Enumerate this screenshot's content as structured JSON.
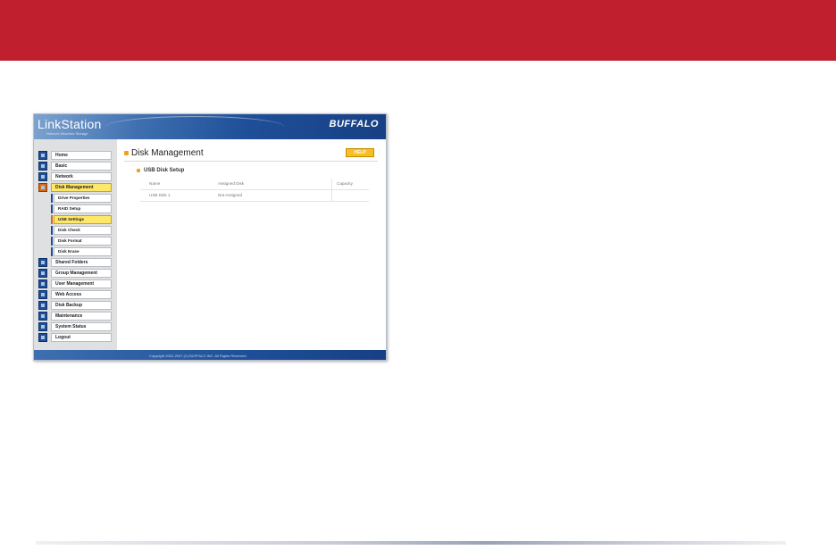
{
  "header": {
    "product": "LinkStation",
    "product_sub": "Network Attached Storage",
    "brand": "BUFFALO"
  },
  "sidebar": {
    "items": [
      {
        "label": "Home",
        "icon": "home-icon",
        "active": false
      },
      {
        "label": "Basic",
        "icon": "basic-settings-icon",
        "active": false
      },
      {
        "label": "Network",
        "icon": "network-icon",
        "active": false
      },
      {
        "label": "Disk Management",
        "icon": "disk-icon",
        "active": true
      },
      {
        "label": "Shared Folders",
        "icon": "folder-icon",
        "active": false
      },
      {
        "label": "Group Management",
        "icon": "group-icon",
        "active": false
      },
      {
        "label": "User Management",
        "icon": "user-icon",
        "active": false
      },
      {
        "label": "Web Access",
        "icon": "web-icon",
        "active": false
      },
      {
        "label": "Disk Backup",
        "icon": "backup-icon",
        "active": false
      },
      {
        "label": "Maintenance",
        "icon": "maintenance-icon",
        "active": false
      },
      {
        "label": "System Status",
        "icon": "status-icon",
        "active": false
      },
      {
        "label": "Logout",
        "icon": "logout-icon",
        "active": false
      }
    ],
    "subitems": [
      {
        "label": "Drive Properties",
        "active": false
      },
      {
        "label": "RAID Setup",
        "active": false
      },
      {
        "label": "USB Settings",
        "active": true
      },
      {
        "label": "Disk Check",
        "active": false
      },
      {
        "label": "Disk Format",
        "active": false
      },
      {
        "label": "Disk Erase",
        "active": false
      }
    ]
  },
  "main": {
    "title": "Disk Management",
    "help_label": "HELP",
    "section_title": "USB Disk Setup",
    "table": {
      "headers": [
        "Name",
        "Assigned Disk",
        "Capacity"
      ],
      "rows": [
        [
          "USB Disk 1",
          "Not Assigned",
          ""
        ]
      ]
    }
  },
  "footer": {
    "copyright": "Copyright 2002-2007 (C) BUFFALO INC. All Rights Reserved."
  },
  "colors": {
    "top_band": "#c0202d",
    "header_blue": "#1f4f98",
    "active_highlight": "#ffe76a",
    "accent_orange": "#f0a020"
  }
}
